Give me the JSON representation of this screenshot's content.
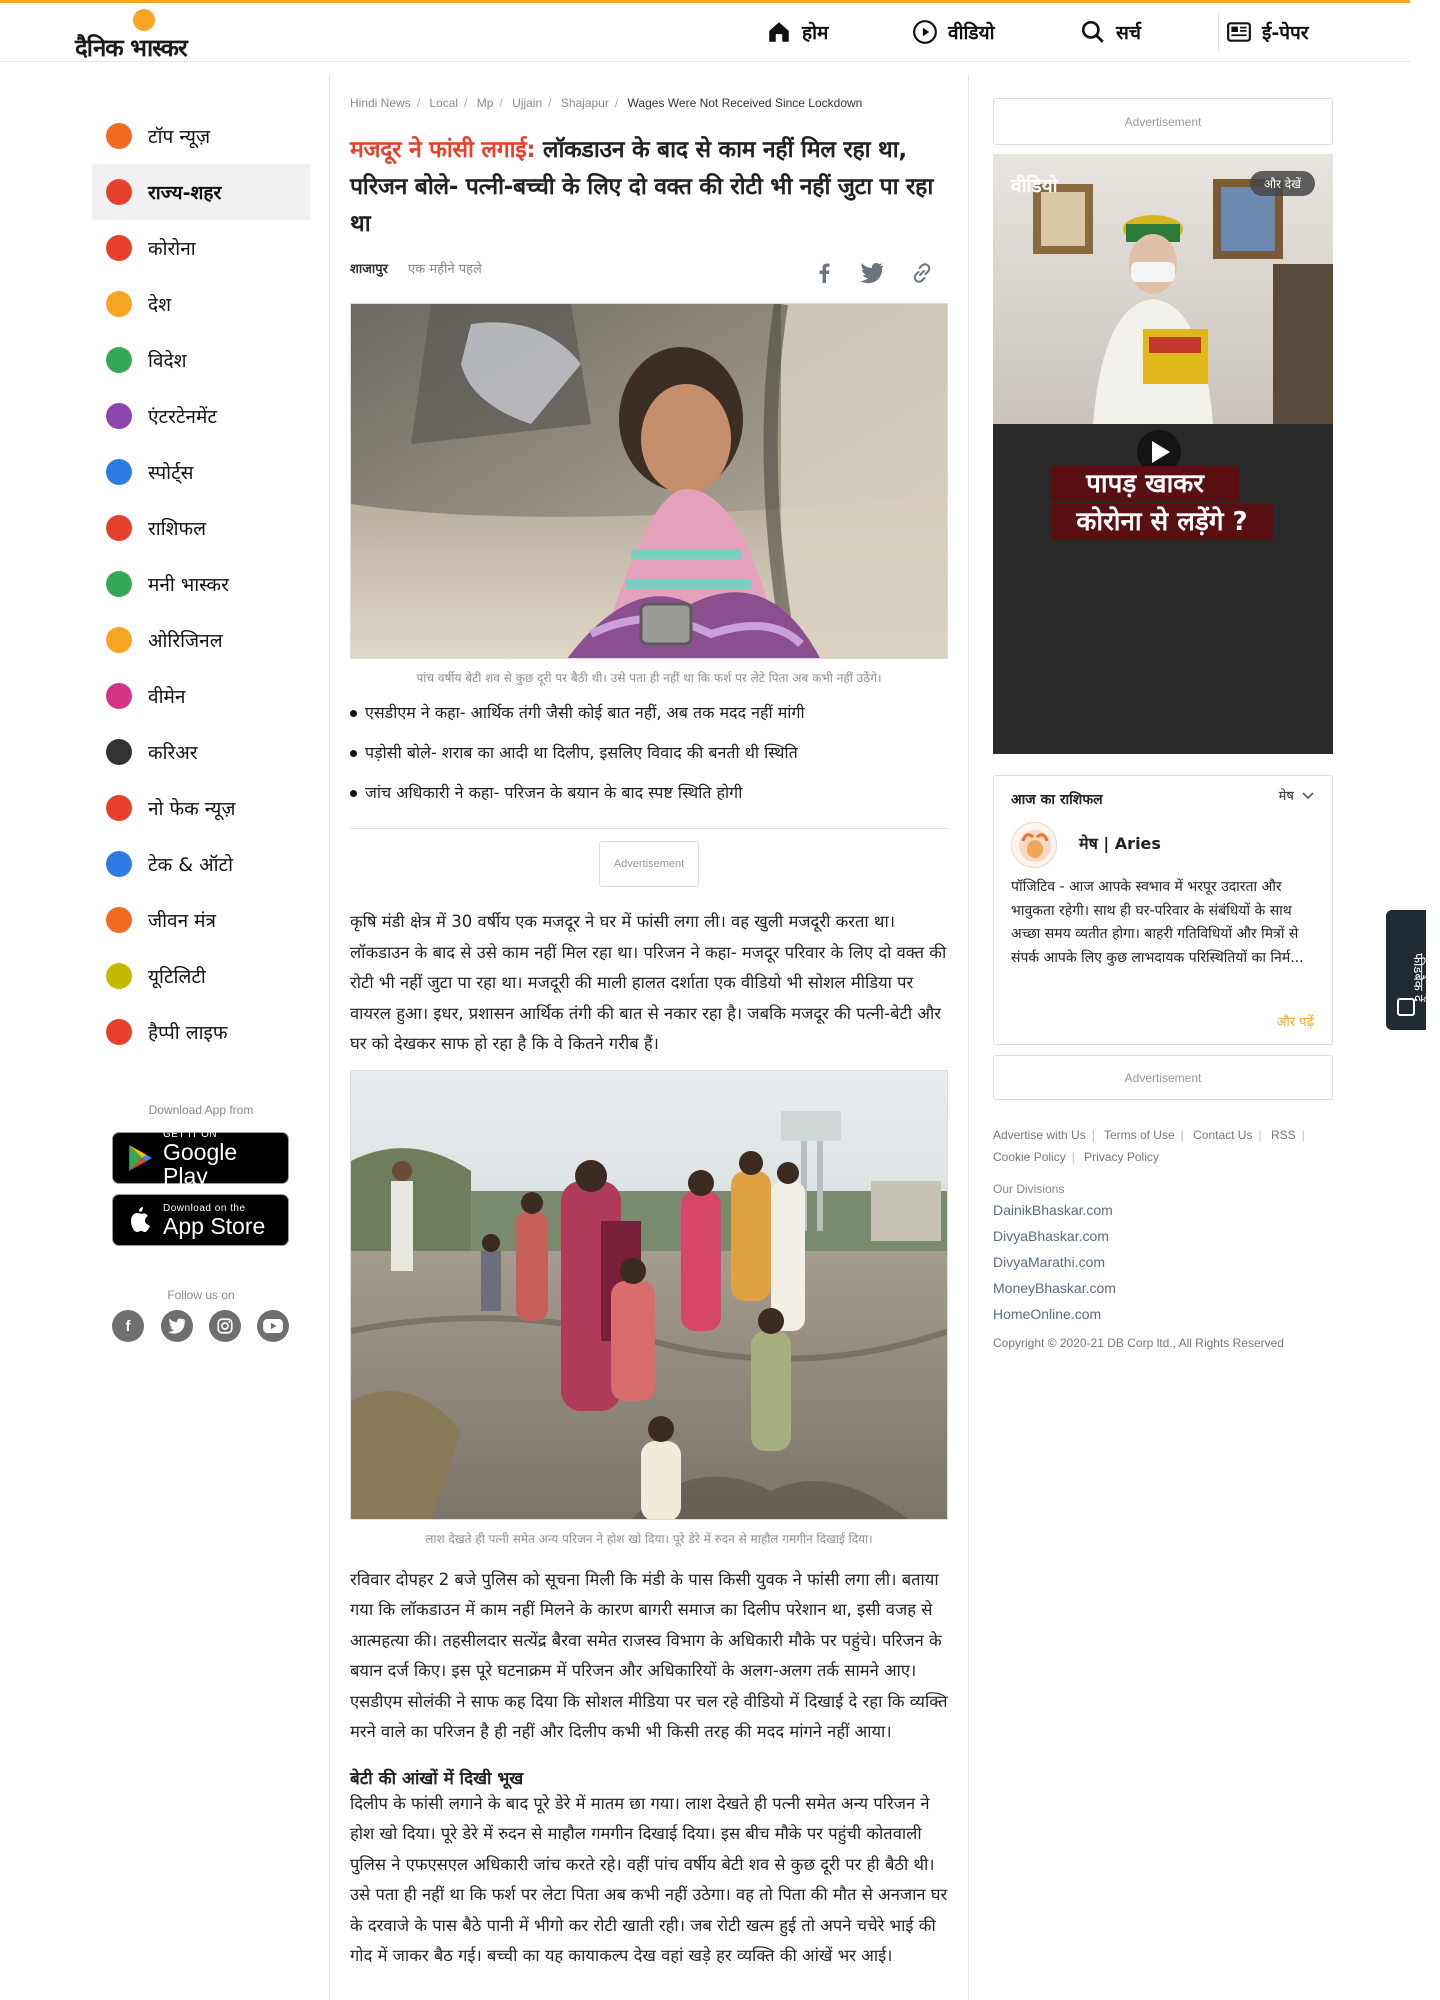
{
  "header": {
    "logo_text": "दैनिक भास्कर",
    "nav": [
      {
        "label": "होम",
        "icon": "home-icon"
      },
      {
        "label": "वीडियो",
        "icon": "play-circle-icon"
      },
      {
        "label": "सर्च",
        "icon": "search-icon"
      },
      {
        "label": "ई-पेपर",
        "icon": "newspaper-icon"
      }
    ]
  },
  "sidebar": {
    "items": [
      {
        "label": "टॉप न्यूज़",
        "icon": "fire-icon",
        "color": "#f36b21"
      },
      {
        "label": "राज्य-शहर",
        "icon": "city-icon",
        "color": "#e8412b"
      },
      {
        "label": "कोरोना",
        "icon": "virus-icon",
        "color": "#e8412b"
      },
      {
        "label": "देश",
        "icon": "india-gate-icon",
        "color": "#f6a623"
      },
      {
        "label": "विदेश",
        "icon": "globe-icon",
        "color": "#34a853"
      },
      {
        "label": "एंटरटेनमेंट",
        "icon": "clapperboard-icon",
        "color": "#8e44ad"
      },
      {
        "label": "स्पोर्ट्स",
        "icon": "runner-icon",
        "color": "#2d7be5"
      },
      {
        "label": "राशिफल",
        "icon": "zodiac-wheel-icon",
        "color": "#e8412b"
      },
      {
        "label": "मनी भास्कर",
        "icon": "rupee-icon",
        "color": "#34a853"
      },
      {
        "label": "ओरिजिनल",
        "icon": "original-icon",
        "color": "#f6a623"
      },
      {
        "label": "वीमेन",
        "icon": "women-icon",
        "color": "#d63384"
      },
      {
        "label": "करिअर",
        "icon": "graduation-cap-icon",
        "color": "#333333"
      },
      {
        "label": "नो फेक न्यूज़",
        "icon": "no-fake-icon",
        "color": "#e8412b"
      },
      {
        "label": "टेक & ऑटो",
        "icon": "car-phone-icon",
        "color": "#2d7be5"
      },
      {
        "label": "जीवन मंत्र",
        "icon": "mantra-icon",
        "color": "#f36b21"
      },
      {
        "label": "यूटिलिटी",
        "icon": "bulb-icon",
        "color": "#c5b800"
      },
      {
        "label": "हैप्पी लाइफ",
        "icon": "heart-people-icon",
        "color": "#e8412b"
      }
    ],
    "active_index": 1,
    "download_label": "Download App from",
    "google_play": {
      "small": "GET IT ON",
      "big": "Google Play"
    },
    "app_store": {
      "small": "Download on the",
      "big": "App Store"
    },
    "follow_label": "Follow us on",
    "socials": [
      "facebook-icon",
      "twitter-icon",
      "instagram-icon",
      "youtube-icon"
    ]
  },
  "article": {
    "breadcrumb": [
      "Hindi News",
      "Local",
      "Mp",
      "Ujjain",
      "Shajapur",
      "Wages Were Not Received Since Lockdown"
    ],
    "kicker": "मजदूर ने फांसी लगाई:",
    "headline": " लॉकडाउन के बाद से काम नहीं मिल रहा था, परिजन बोले- पत्नी-बच्ची के लिए दो वक्त की रोटी भी नहीं जुटा पा रहा था",
    "city": "शाजापुर",
    "time": "एक महीने पहले",
    "caption1": "पांच वर्षीय बेटी शव से कुछ दूरी पर बैठी थी। उसे पता ही नहीं था कि फर्श पर लेटे पिता अब कभी नहीं उठेंगे।",
    "bullets": [
      "एसडीएम ने कहा- आर्थिक तंगी जैसी कोई बात नहीं, अब तक मदद नहीं मांगी",
      "पड़ोसी बोले- शराब का आदी था दिलीप, इसलिए विवाद की बनती थी स्थिति",
      "जांच अधिकारी ने कहा- परिजन के बयान के बाद स्पष्ट स्थिति होगी"
    ],
    "ad_label": "Advertisement",
    "para1": "कृषि मंडी क्षेत्र में 30 वर्षीय एक मजदूर ने घर में फांसी लगा ली। वह खुली मजदूरी करता था। लॉकडाउन के बाद से उसे काम नहीं मिल रहा था। परिजन ने कहा- मजदूर परिवार के लिए दो वक्त की रोटी भी नहीं जुटा पा रहा था। मजदूरी की माली हालत दर्शाता एक वीडियो भी सोशल मीडिया पर वायरल हुआ। इधर, प्रशासन आर्थिक तंगी की बात से नकार रहा है। जबकि मजदूर की पत्नी-बेटी और घर को देखकर साफ हो रहा है कि वे कितने गरीब हैं।",
    "caption2": "लाश देखते ही पत्नी समेत अन्य परिजन ने होश खो दिया। पूरे डेरे में रुदन से माहौल गमगीन दिखाई दिया।",
    "para2": "रविवार दोपहर 2 बजे पुलिस को सूचना मिली कि मंडी के पास किसी युवक ने फांसी लगा ली। बताया गया कि लॉकडाउन में काम नहीं मिलने के कारण बागरी समाज का दिलीप परेशान था, इसी वजह से आत्महत्या की। तहसीलदार सत्येंद्र बैरवा समेत राजस्व विभाग के अधिकारी मौके पर पहुंचे। परिजन के बयान दर्ज किए। इस पूरे घटनाक्रम में परिजन और अधिकारियों के अलग-अलग तर्क सामने आए। एसडीएम सोलंकी ने साफ कह दिया कि सोशल मीडिया पर चल रहे वीडियो में दिखाई दे रहा कि व्यक्ति मरने वाले का परिजन है ही नहीं और दिलीप कभी भी किसी तरह की मदद मांगने नहीं आया।",
    "subhead": "बेटी की आंखों में दिखी भूख",
    "para3": "दिलीप के फांसी लगाने के बाद पूरे डेरे में मातम छा गया। लाश देखते ही पत्नी समेत अन्य परिजन ने होश खो दिया। पूरे डेरे में रुदन से माहौल गमगीन दिखाई दिया। इस बीच मौके पर पहुंची कोतवाली पुलिस ने एफएसएल अधिकारी जांच करते रहे। वहीं पांच वर्षीय बेटी शव से कुछ दूरी पर ही बैठी थी। उसे पता ही नहीं था कि फर्श पर लेटा पिता अब कभी नहीं उठेगा। वह तो पिता की मौत से अनजान घर के दरवाजे के पास बैठे पानी में भीगो कर रोटी खाती रही। जब रोटी खत्म हुई तो अपने चचेरे भाई की गोद में जाकर बैठ गई। बच्ची का यह कायाकल्प देख वहां खड़े हर व्यक्ति की आंखें भर आई।"
  },
  "rail": {
    "ad_label": "Advertisement",
    "video": {
      "title": "वीडियो",
      "more": "और देखें",
      "overlay_line1": "पापड़ खाकर",
      "overlay_line2": "कोरोना से लड़ेंगे ?"
    },
    "horoscope": {
      "title": "आज का राशिफल",
      "selected": "मेष",
      "sign": "मेष | Aries",
      "text": "पॉजिटिव - आज आपके स्वभाव में भरपूर उदारता और भावुकता रहेगी। साथ ही घर-परिवार के संबंधियों के साथ अच्छा समय व्यतीत होगा। बाहरी गतिविधियों और मित्रों से संपर्क आपके लिए कुछ लाभदायक परिस्थितियों का निर्म...",
      "more": "और पढ़ें"
    },
    "footer_links": [
      "Advertise with Us",
      "Terms of Use",
      "Contact Us",
      "RSS",
      "Cookie Policy",
      "Privacy Policy"
    ],
    "divisions_label": "Our Divisions",
    "divisions": [
      "DainikBhaskar.com",
      "DivyaBhaskar.com",
      "DivyaMarathi.com",
      "MoneyBhaskar.com",
      "HomeOnline.com"
    ],
    "copyright": "Copyright © 2020-21 DB Corp ltd., All Rights Reserved"
  },
  "feedback": {
    "label": "फीडबैक दें"
  }
}
